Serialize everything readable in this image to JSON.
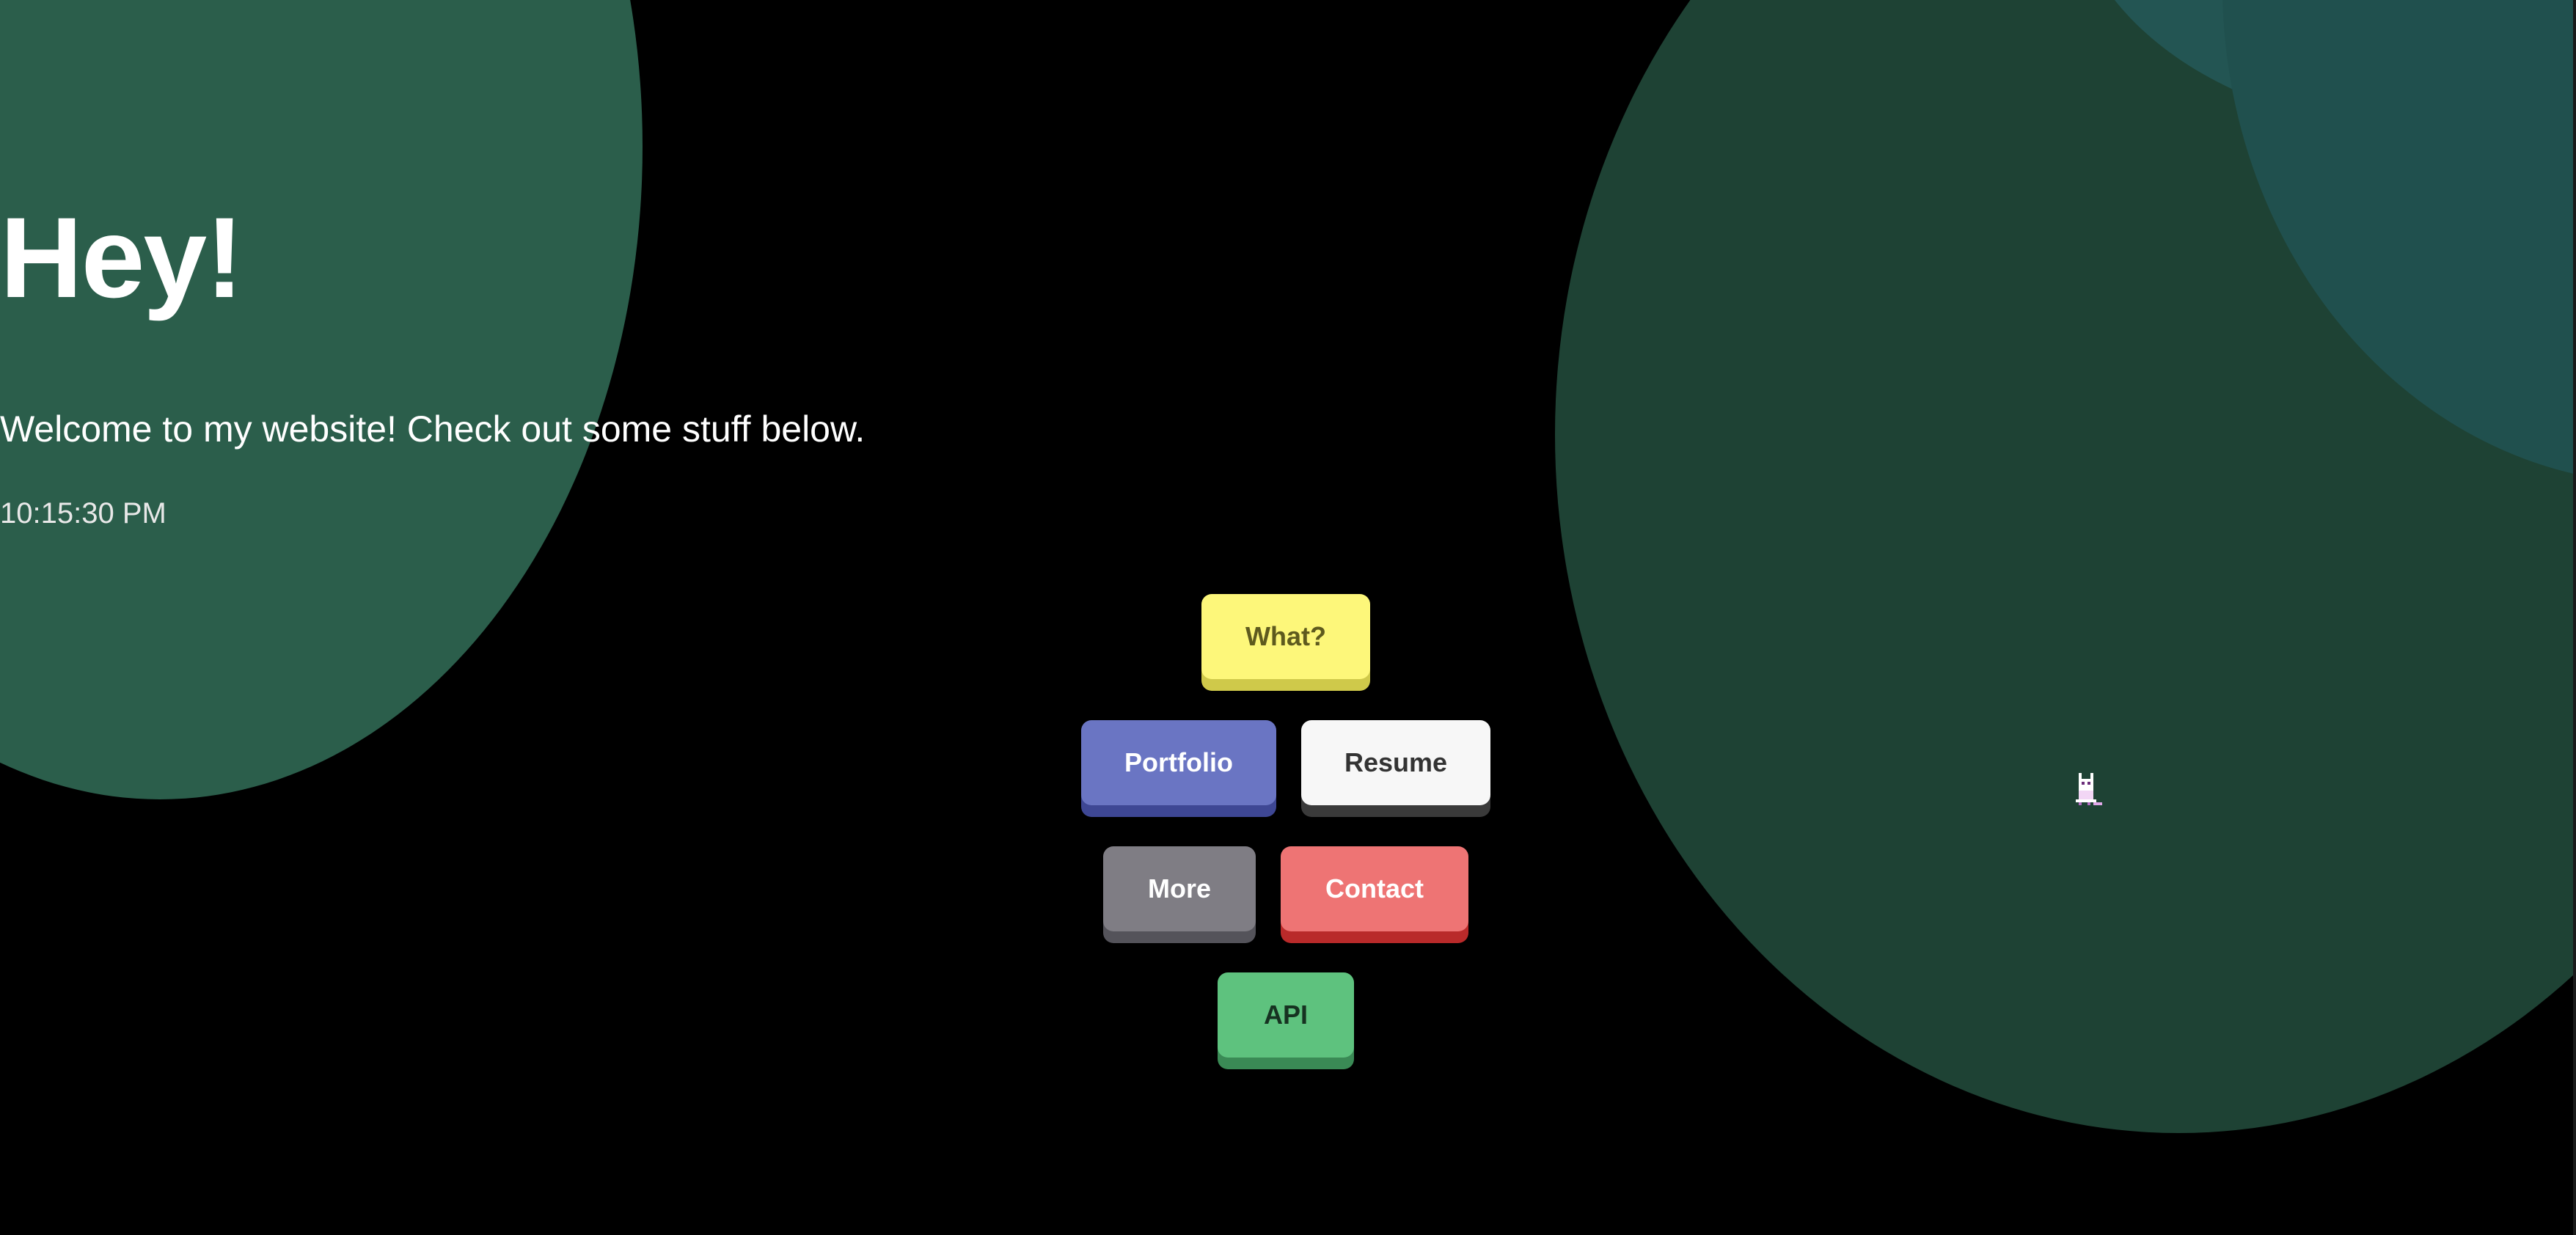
{
  "page": {
    "title": "Hey!",
    "subtitle": "Welcome to my website! Check out some stuff below.",
    "clock": "10:15:30 PM"
  },
  "buttons": {
    "what": "What?",
    "portfolio": "Portfolio",
    "resume": "Resume",
    "more": "More",
    "contact": "Contact",
    "api": "API"
  },
  "colors": {
    "background": "#000000",
    "blob_left": "#2b5e4b",
    "blob_right": "#1e4234",
    "blob_teal": "#20504e",
    "what": "#fdf77a",
    "portfolio": "#6a75c3",
    "resume": "#f7f7f7",
    "more": "#7f7d84",
    "contact": "#ee7474",
    "api": "#5ec27e"
  },
  "icons": {
    "pet": "pixel-cat-icon"
  }
}
